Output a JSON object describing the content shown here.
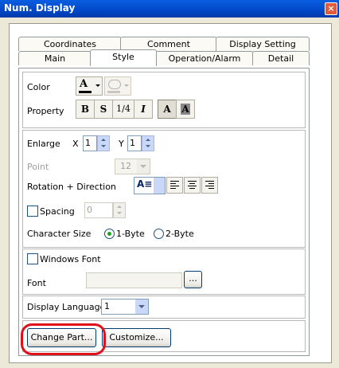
{
  "window": {
    "title": "Num. Display"
  },
  "tabs": {
    "row1": [
      "Coordinates",
      "Comment",
      "Display Setting"
    ],
    "row2": [
      "Main",
      "Style",
      "Operation/Alarm",
      "Detail"
    ],
    "active": "Style"
  },
  "style": {
    "color_label": "Color",
    "color_letter": "A",
    "property_label": "Property",
    "property_buttons": [
      "B",
      "S",
      "1/4",
      "I",
      "A",
      "A"
    ],
    "enlarge_label": "Enlarge",
    "enlarge_x_label": "X",
    "enlarge_x_value": "1",
    "enlarge_y_label": "Y",
    "enlarge_y_value": "1",
    "point_label": "Point",
    "point_value": "12",
    "rotation_label": "Rotation + Direction",
    "spacing_label": "Spacing",
    "spacing_value": "0",
    "char_size_label": "Character Size",
    "char_size_options": [
      "1-Byte",
      "2-Byte"
    ],
    "char_size_selected": "1-Byte",
    "windows_font_label": "Windows Font",
    "font_label": "Font",
    "font_value": "",
    "font_browse_label": "...",
    "display_language_label": "Display Language",
    "display_language_value": "1",
    "change_part_label": "Change Part...",
    "customize_label": "Customize..."
  },
  "colors": {
    "title_bar": "#0054e3",
    "highlight": "#e0101a",
    "panel": "#ffffff",
    "window_bg": "#ece9d8"
  }
}
